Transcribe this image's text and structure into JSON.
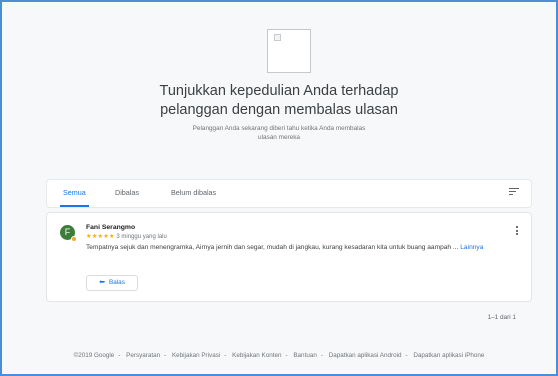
{
  "hero": {
    "image_icon": "broken-image-icon",
    "title_line1": "Tunjukkan kepedulian Anda terhadap",
    "title_line2": "pelanggan dengan membalas ulasan",
    "subtitle_line1": "Pelanggan Anda sekarang diberi tahu ketika Anda membalas",
    "subtitle_line2": "ulasan mereka"
  },
  "tabs": {
    "items": [
      {
        "label": "Semua",
        "active": true
      },
      {
        "label": "Dibalas",
        "active": false
      },
      {
        "label": "Belum dibalas",
        "active": false
      }
    ],
    "filter_icon": "filter-sort-icon"
  },
  "review": {
    "avatar_letter": "F",
    "reviewer_name": "Fani Serangmo",
    "stars": "★★★★★",
    "rating": 5,
    "time_ago": "3 minggu yang lalu",
    "text": "Tempatnya sejuk dan menengramka, Airnya jernih dan segar, mudah di jangkau, kurang kesadaran kita untuk buang aampah ...",
    "more_label": "Lainnya",
    "reply_label": "Balas",
    "reply_icon": "reply-arrow-icon",
    "menu_icon": "more-vert-icon"
  },
  "pagination": {
    "text": "1–1 dari 1"
  },
  "footer": {
    "links": [
      "©2019 Google",
      "Persyaratan",
      "Kebijakan Privasi",
      "Kebijakan Konten",
      "Bantuan",
      "Dapatkan aplikasi Android",
      "Dapatkan aplikasi iPhone"
    ],
    "separator": "-"
  },
  "colors": {
    "accent": "#1a73e8",
    "star": "#f4b400",
    "avatar": "#3d7d3a",
    "frame": "#4a8fd6"
  }
}
